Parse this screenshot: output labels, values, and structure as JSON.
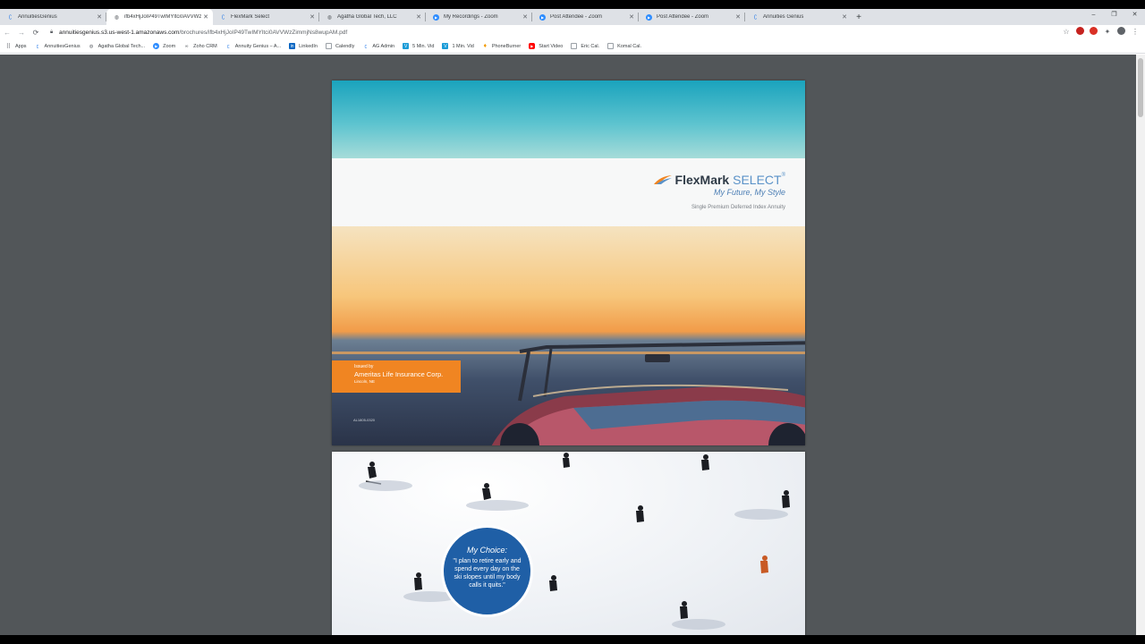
{
  "tabs": [
    {
      "title": "AnnuitiesGenius",
      "icon": "annuities-genius-icon",
      "active": false
    },
    {
      "title": "ifb4xHjJoIP49TwIMYltci0AVVWz",
      "icon": "globe-icon",
      "active": true
    },
    {
      "title": "FlexMark Select",
      "icon": "annuities-genius-icon",
      "active": false
    },
    {
      "title": "Agatha Global Tech, LLC",
      "icon": "globe-icon",
      "active": false
    },
    {
      "title": "My Recordings - Zoom",
      "icon": "zoom-icon",
      "active": false
    },
    {
      "title": "Post Attendee - Zoom",
      "icon": "zoom-icon",
      "active": false
    },
    {
      "title": "Post Attendee - Zoom",
      "icon": "zoom-icon",
      "active": false
    },
    {
      "title": "Annuities Genius",
      "icon": "annuities-genius-icon",
      "active": false
    }
  ],
  "new_tab_label": "+",
  "window_controls": {
    "minimize": "–",
    "restore": "❐",
    "close": "✕"
  },
  "nav": {
    "back": "←",
    "forward": "→",
    "reload": "⟳"
  },
  "address": {
    "host": "annuitiesgenius.s3.us-west-1.amazonaws.com",
    "path": "/brochures/ifb4xHjJoIP49TwIMYltci0AVVWzZimmjNs8wupAM.pdf"
  },
  "toolbar_icons": {
    "star": "☆",
    "puzzle": "✦",
    "menu": "⋮"
  },
  "bookmarks": [
    {
      "label": "Apps",
      "icon": "apps-grid-icon",
      "color": "#5f6368"
    },
    {
      "label": "AnnuitiesGenius",
      "icon": "annuities-genius-icon",
      "color": "#1a73e8"
    },
    {
      "label": "Agatha Global Tech...",
      "icon": "globe-icon",
      "color": "#5f6368"
    },
    {
      "label": "Zoom",
      "icon": "zoom-icon",
      "color": "#2d8cff"
    },
    {
      "label": "Zoho CRM",
      "icon": "zoho-icon",
      "color": "#5f6368"
    },
    {
      "label": "Annuity Genius – A...",
      "icon": "annuities-genius-icon",
      "color": "#1a73e8"
    },
    {
      "label": "LinkedIn",
      "icon": "linkedin-icon",
      "color": "#0a66c2"
    },
    {
      "label": "Calendly",
      "icon": "page-icon",
      "color": "#9aa0a6"
    },
    {
      "label": "AG Admin",
      "icon": "annuities-genius-icon",
      "color": "#1a73e8"
    },
    {
      "label": "5 Min. Vid",
      "icon": "vidyard-icon",
      "color": "#1a9bd7"
    },
    {
      "label": "1 Min. Vid",
      "icon": "vidyard-icon",
      "color": "#1a9bd7"
    },
    {
      "label": "PhoneBurner",
      "icon": "phoneburner-icon",
      "color": "#f29900"
    },
    {
      "label": "Start Video",
      "icon": "youtube-icon",
      "color": "#ff0000"
    },
    {
      "label": "Eric Cal.",
      "icon": "page-icon",
      "color": "#9aa0a6"
    },
    {
      "label": "Komal Cal.",
      "icon": "page-icon",
      "color": "#9aa0a6"
    }
  ],
  "brochure": {
    "brand_main": "FlexMark",
    "brand_sub": " SELECT",
    "registered": "®",
    "tagline": "My Future, My Style",
    "product": "Single Premium Deferred Index Annuity",
    "issued_by": "Issued by",
    "issuer": "Ameritas Life Insurance Corp.",
    "city": "Lincoln, NE",
    "form_code": "AL1805-0320"
  },
  "page2": {
    "choice_title": "My Choice:",
    "choice_quote": "\"I plan to retire early and spend every day on the ski slopes until my body calls it quits.\""
  },
  "colors": {
    "viewer_bg": "#525659",
    "orange": "#f08522",
    "blue_circle": "#1f5fa6"
  }
}
